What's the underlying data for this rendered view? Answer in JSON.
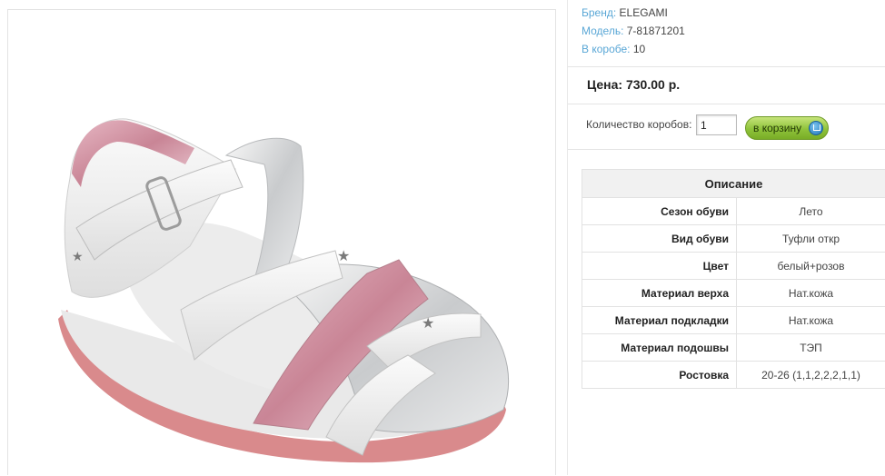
{
  "product": {
    "brand_label": "Бренд:",
    "brand": "ELEGAMI",
    "model_label": "Модель:",
    "model": "7-81871201",
    "box_label": "В коробе:",
    "box_qty": "10",
    "price": "Цена: 730.00 р."
  },
  "order": {
    "qty_label": "Количество коробов:",
    "qty_value": "1",
    "cart_button": "в корзину"
  },
  "specs": {
    "title": "Описание",
    "rows": [
      {
        "key": "Сезон обуви",
        "value": "Лето"
      },
      {
        "key": "Вид обуви",
        "value": "Туфли откр"
      },
      {
        "key": "Цвет",
        "value": "белый+розов"
      },
      {
        "key": "Материал верха",
        "value": "Нат.кожа"
      },
      {
        "key": "Материал подкладки",
        "value": "Нат.кожа"
      },
      {
        "key": "Материал подошвы",
        "value": "ТЭП"
      },
      {
        "key": "Ростовка",
        "value": "20-26 (1,1,2,2,2,1,1)"
      }
    ]
  },
  "colors": {
    "accent_label": "#5aa7d6",
    "button_green": "#8fc33b",
    "pink_metallic": "#cf9aa8"
  }
}
